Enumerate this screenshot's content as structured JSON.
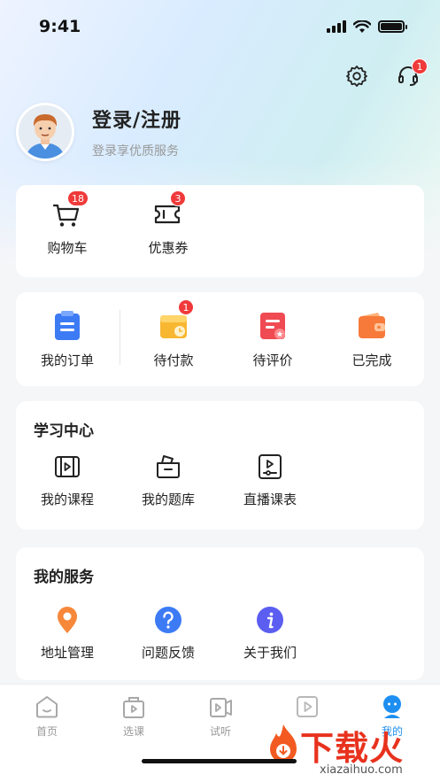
{
  "status_bar": {
    "time": "9:41"
  },
  "header": {
    "notification_count": "1"
  },
  "profile": {
    "title": "登录/注册",
    "subtitle": "登录享优质服务"
  },
  "quick": {
    "cart": {
      "label": "购物车",
      "badge": "18",
      "icon": "cart-icon"
    },
    "coupon": {
      "label": "优惠券",
      "badge": "3",
      "icon": "ticket-icon"
    }
  },
  "orders": {
    "all": {
      "label": "我的订单",
      "icon": "orders-icon",
      "color": "#3d7bf5"
    },
    "pending_payment": {
      "label": "待付款",
      "badge": "1",
      "icon": "wallet-clock-icon",
      "color": "#f7b731"
    },
    "pending_review": {
      "label": "待评价",
      "icon": "review-icon",
      "color": "#f04a52"
    },
    "completed": {
      "label": "已完成",
      "icon": "wallet-icon",
      "color": "#f77a3a"
    }
  },
  "study": {
    "title": "学习中心",
    "items": [
      {
        "label": "我的课程",
        "icon": "course-video-icon"
      },
      {
        "label": "我的题库",
        "icon": "question-bank-icon"
      },
      {
        "label": "直播课表",
        "icon": "live-schedule-icon"
      }
    ]
  },
  "services": {
    "title": "我的服务",
    "items": [
      {
        "label": "地址管理",
        "icon": "location-icon",
        "color": "#f7883a"
      },
      {
        "label": "问题反馈",
        "icon": "help-icon",
        "color": "#3d7bf5"
      },
      {
        "label": "关于我们",
        "icon": "info-icon",
        "color": "#5b5ef0"
      }
    ]
  },
  "tabbar": {
    "items": [
      {
        "label": "首页",
        "icon": "home-icon"
      },
      {
        "label": "选课",
        "icon": "course-select-icon"
      },
      {
        "label": "试听",
        "icon": "trial-icon"
      },
      {
        "label": "",
        "icon": "play-icon"
      },
      {
        "label": "我的",
        "icon": "profile-icon",
        "active": true
      }
    ],
    "active_color": "#1e8ff0"
  },
  "watermark": {
    "main": "下载火",
    "sub": "xiazaihuo.com"
  }
}
